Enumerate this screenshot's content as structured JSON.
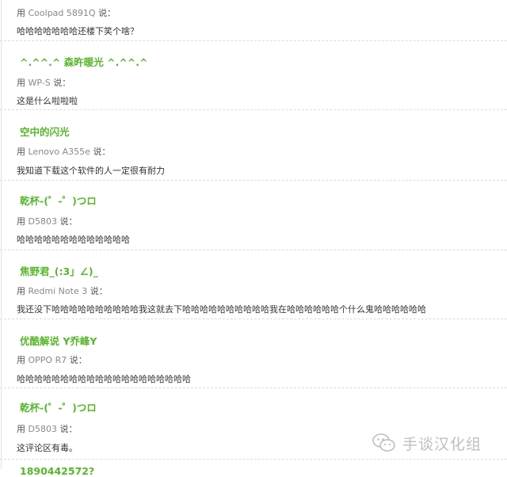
{
  "comments": [
    {
      "name": "",
      "prefix": "用",
      "device": "Coolpad 5891Q",
      "suffix": "说：",
      "text": "哈哈哈哈哈哈哈还楼下笑个啥？"
    },
    {
      "name": "^.^^.^ 森旿暖光 ^.^^.^",
      "prefix": "用",
      "device": "WP-S",
      "suffix": "说：",
      "text": "这是什么啦啦啦"
    },
    {
      "name": "空中的闪光",
      "prefix": "用",
      "device": "Lenovo A355e",
      "suffix": "说：",
      "text": "我知道下载这个软件的人一定很有耐力"
    },
    {
      "name": "乾杯-(゜-゜)つロ",
      "prefix": "用",
      "device": "D5803",
      "suffix": "说：",
      "text": "哈哈哈哈哈哈哈哈哈哈哈哈哈"
    },
    {
      "name": "焦野君_(:3」∠)_",
      "prefix": "用",
      "device": "Redmi Note 3",
      "suffix": "说：",
      "text": "我还没下哈哈哈哈哈哈哈哈哈哈我这就去下哈哈哈哈哈哈哈哈哈哈我在哈哈哈哈哈哈个什么鬼哈哈哈哈哈哈"
    },
    {
      "name": "优酷解说 Y乔峰Y",
      "prefix": "用",
      "device": "OPPO R7",
      "suffix": "说：",
      "text": "哈哈哈哈哈哈哈哈哈哈哈哈哈哈哈哈哈哈哈哈"
    },
    {
      "name": "乾杯-(゜-゜)つロ",
      "prefix": "用",
      "device": "D5803",
      "suffix": "说：",
      "text": "这评论区有毒。"
    },
    {
      "name": "1890442572?"
    }
  ],
  "watermark": {
    "text": "手谈汉化组",
    "icon": "wechat-icon"
  }
}
